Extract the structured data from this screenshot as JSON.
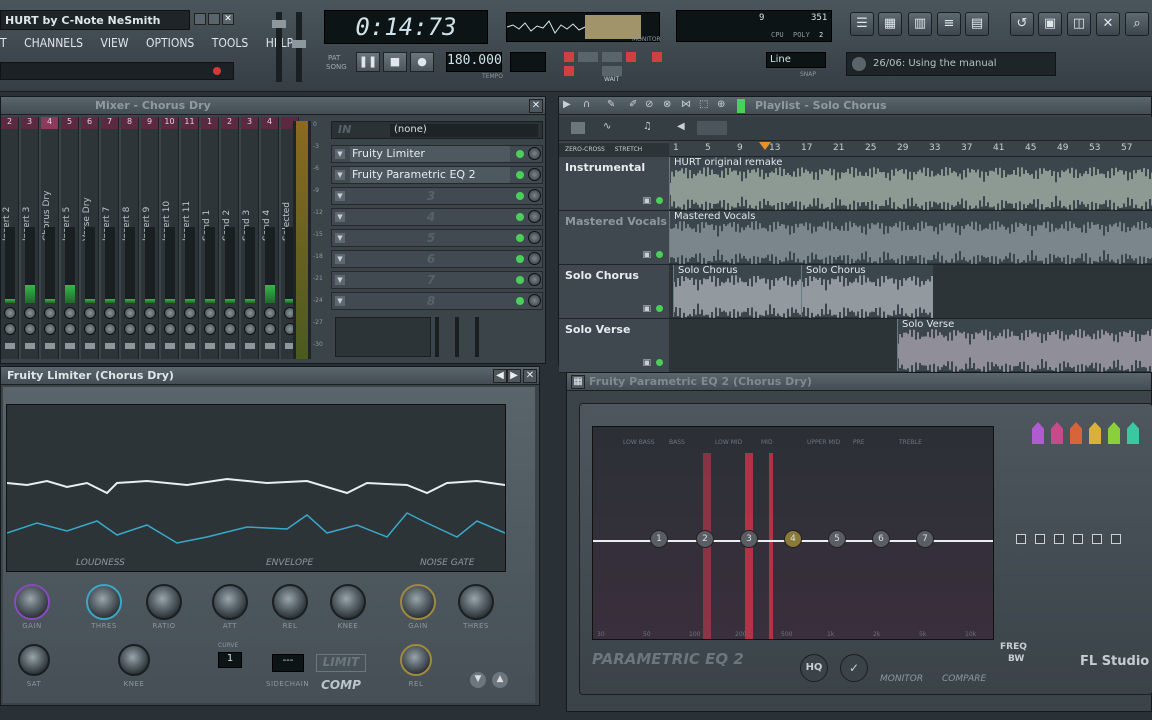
{
  "app": {
    "title": "HURT by C-Note NeSmith",
    "menu": [
      "T",
      "CHANNELS",
      "VIEW",
      "OPTIONS",
      "TOOLS",
      "HELP"
    ],
    "time": "0:14:73",
    "tempo": "180.000",
    "tempo_label": "TEMPO",
    "monitor_label": "MONITOR",
    "pat_label": "PAT",
    "song_label": "SONG",
    "cpu_value": "9",
    "ram_value": "351",
    "cpu_label": "CPU",
    "poly_label": "POLY",
    "poly_value": "2",
    "snap_value": "Line",
    "snap_label": "SNAP",
    "hint": "26/06: Using the manual",
    "wait_label": "WAIT"
  },
  "mixer": {
    "title": "Mixer - Chorus Dry",
    "tracks": [
      {
        "num": "2",
        "name": "Insert 2"
      },
      {
        "num": "3",
        "name": "Insert 3"
      },
      {
        "num": "4",
        "name": "Chorus Dry"
      },
      {
        "num": "5",
        "name": "Insert 5"
      },
      {
        "num": "6",
        "name": "Verse Dry"
      },
      {
        "num": "7",
        "name": "Insert 7"
      },
      {
        "num": "8",
        "name": "Insert 8"
      },
      {
        "num": "9",
        "name": "Insert 9"
      },
      {
        "num": "10",
        "name": "Insert 10"
      },
      {
        "num": "11",
        "name": "Insert 11"
      },
      {
        "num": "1",
        "name": "Send 1"
      },
      {
        "num": "2",
        "name": "Send 2"
      },
      {
        "num": "3",
        "name": "Send 3"
      },
      {
        "num": "4",
        "name": "Send 4"
      },
      {
        "num": "",
        "name": "Selected"
      }
    ],
    "input_label": "IN",
    "input_value": "(none)",
    "slots": [
      "Fruity Limiter",
      "Fruity Parametric EQ 2",
      "3",
      "4",
      "5",
      "6",
      "7",
      "8"
    ],
    "db_scale": [
      "0",
      "-3",
      "-6",
      "-9",
      "-12",
      "-15",
      "-18",
      "-21",
      "-24",
      "-27",
      "-30"
    ]
  },
  "playlist": {
    "title": "Playlist - Solo Chorus",
    "zero_cross": "ZERO-CROSS",
    "stretch": "STRETCH",
    "ruler": [
      "1",
      "5",
      "9",
      "13",
      "17",
      "21",
      "25",
      "29",
      "33",
      "37",
      "41",
      "45",
      "49",
      "53",
      "57"
    ],
    "tracks": [
      {
        "name": "Instrumental",
        "clips": [
          {
            "name": "HURT original remake"
          }
        ]
      },
      {
        "name": "Mastered Vocals",
        "clips": [
          {
            "name": "Mastered Vocals"
          }
        ]
      },
      {
        "name": "Solo Chorus",
        "clips": [
          {
            "name": "Solo Chorus"
          },
          {
            "name": "Solo Chorus"
          }
        ]
      },
      {
        "name": "Solo Verse",
        "clips": [
          {
            "name": "Solo Verse"
          }
        ]
      }
    ]
  },
  "limiter": {
    "title": "Fruity Limiter (Chorus Dry)",
    "sections": [
      "LOUDNESS",
      "ENVELOPE",
      "NOISE GATE"
    ],
    "knobs_row1": [
      "GAIN",
      "THRES",
      "RATIO",
      "ATT",
      "REL",
      "KNEE",
      "GAIN",
      "THRES"
    ],
    "knobs_row2": [
      "SAT",
      "KNEE",
      "SIDECHAIN",
      "REL"
    ],
    "limit_label": "LIMIT",
    "comp_label": "COMP",
    "curve_label": "CURVE",
    "curve_value": "1",
    "sidechain_value": "---"
  },
  "eq": {
    "title": "Fruity Parametric EQ 2 (Chorus Dry)",
    "bands": [
      "1",
      "2",
      "3",
      "4",
      "5",
      "6",
      "7"
    ],
    "top_labels": [
      "LOW BASS",
      "BASS",
      "LOW MID",
      "MID",
      "UPPER MID",
      "PRE",
      "TREBLE"
    ],
    "freq_labels": [
      "30",
      "50",
      "100",
      "200",
      "500",
      "1k",
      "2k",
      "5k",
      "10k"
    ],
    "brand": "PARAMETRIC EQ 2",
    "hq": "HQ",
    "monitor": "MONITOR",
    "compare": "COMPARE",
    "freq": "FREQ",
    "bw": "BW",
    "watermark": "FL Studio",
    "band_colors": [
      "#b05cd0",
      "#c84a8a",
      "#d8643a",
      "#d8b03a",
      "#8ad03a",
      "#3ac8a0",
      "#3aa8d8"
    ]
  }
}
